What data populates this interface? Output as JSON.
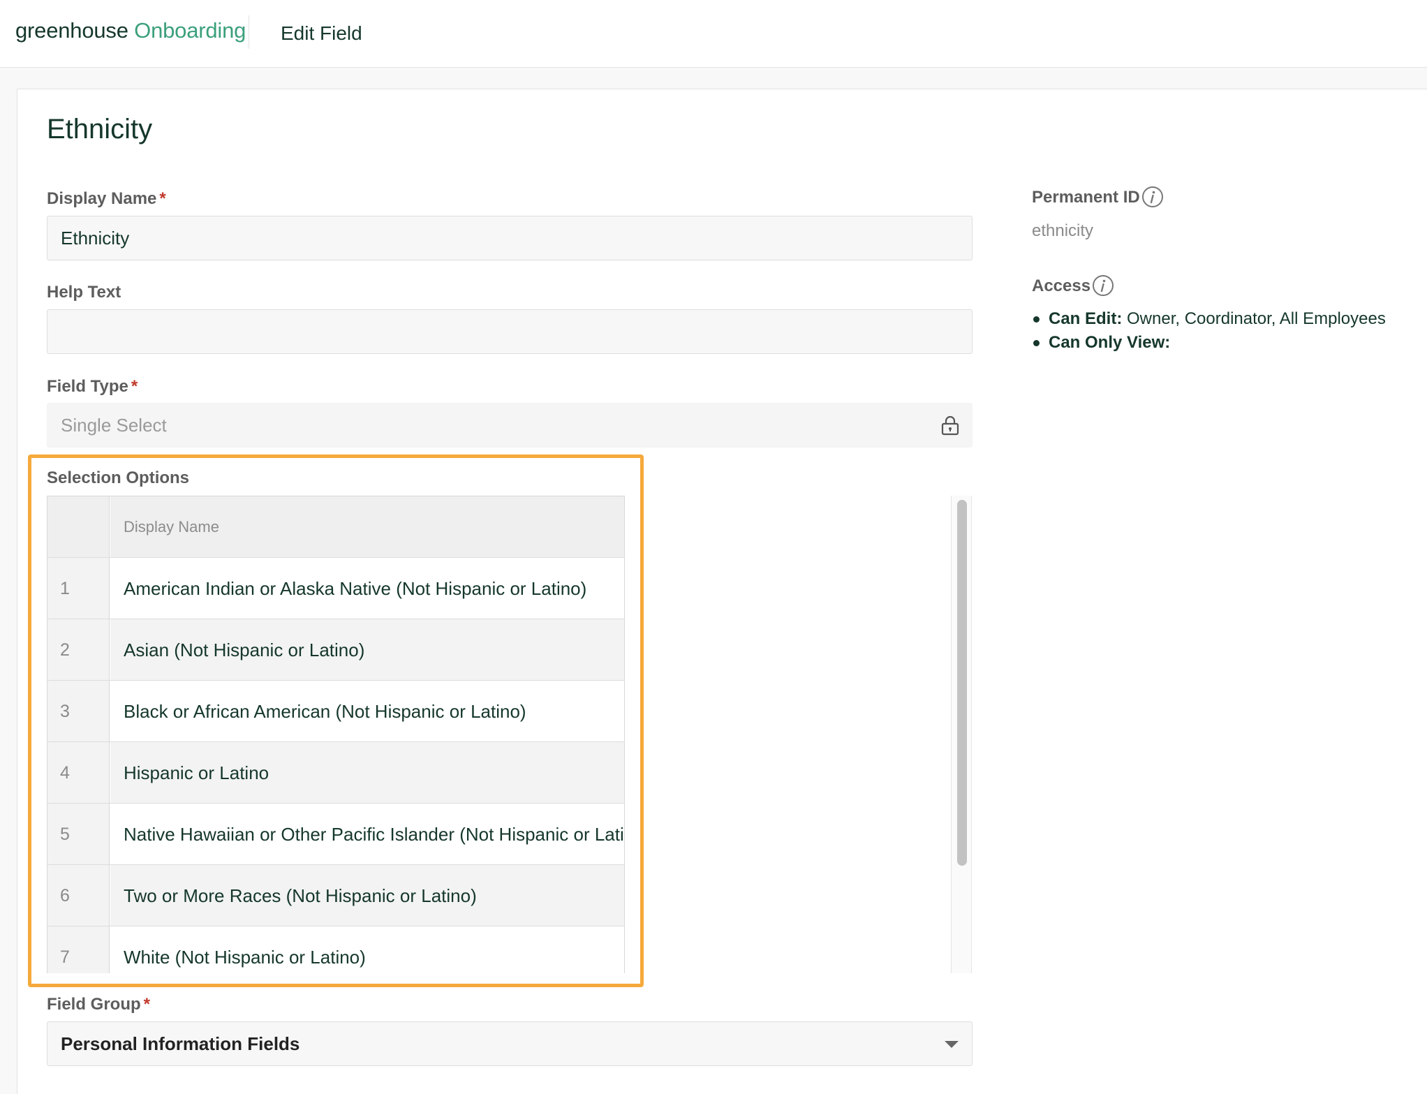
{
  "header": {
    "logo_main": "greenhouse",
    "logo_accent": "Onboarding",
    "title": "Edit Field"
  },
  "page": {
    "title": "Ethnicity"
  },
  "form": {
    "display_name_label": "Display Name",
    "display_name_value": "Ethnicity",
    "help_text_label": "Help Text",
    "help_text_value": "",
    "field_type_label": "Field Type",
    "field_type_value": "Single Select",
    "selection_options_label": "Selection Options",
    "field_group_label": "Field Group",
    "field_group_value": "Personal Information Fields",
    "required_marker": "*"
  },
  "options_table": {
    "header": "Display Name",
    "rows": [
      {
        "index": "1",
        "name": "American Indian or Alaska Native (Not Hispanic or Latino)"
      },
      {
        "index": "2",
        "name": "Asian (Not Hispanic or Latino)"
      },
      {
        "index": "3",
        "name": "Black or African American (Not Hispanic or Latino)"
      },
      {
        "index": "4",
        "name": "Hispanic or Latino"
      },
      {
        "index": "5",
        "name": "Native Hawaiian or Other Pacific Islander (Not Hispanic or Latino)"
      },
      {
        "index": "6",
        "name": "Two or More Races (Not Hispanic or Latino)"
      },
      {
        "index": "7",
        "name": "White (Not Hispanic or Latino)"
      }
    ]
  },
  "sidebar": {
    "permanent_id_label": "Permanent ID",
    "permanent_id_value": "ethnicity",
    "access_label": "Access",
    "can_edit_label": "Can Edit:",
    "can_edit_value": "Owner, Coordinator, All Employees",
    "can_view_label": "Can Only View:",
    "can_view_value": ""
  },
  "colors": {
    "brand_dark": "#15372c",
    "brand_green": "#3ba07a",
    "highlight": "#f6a93b",
    "required": "#c0392b"
  },
  "icons": {
    "lock": "lock-icon",
    "info": "info-icon",
    "caret": "chevron-down-icon"
  }
}
